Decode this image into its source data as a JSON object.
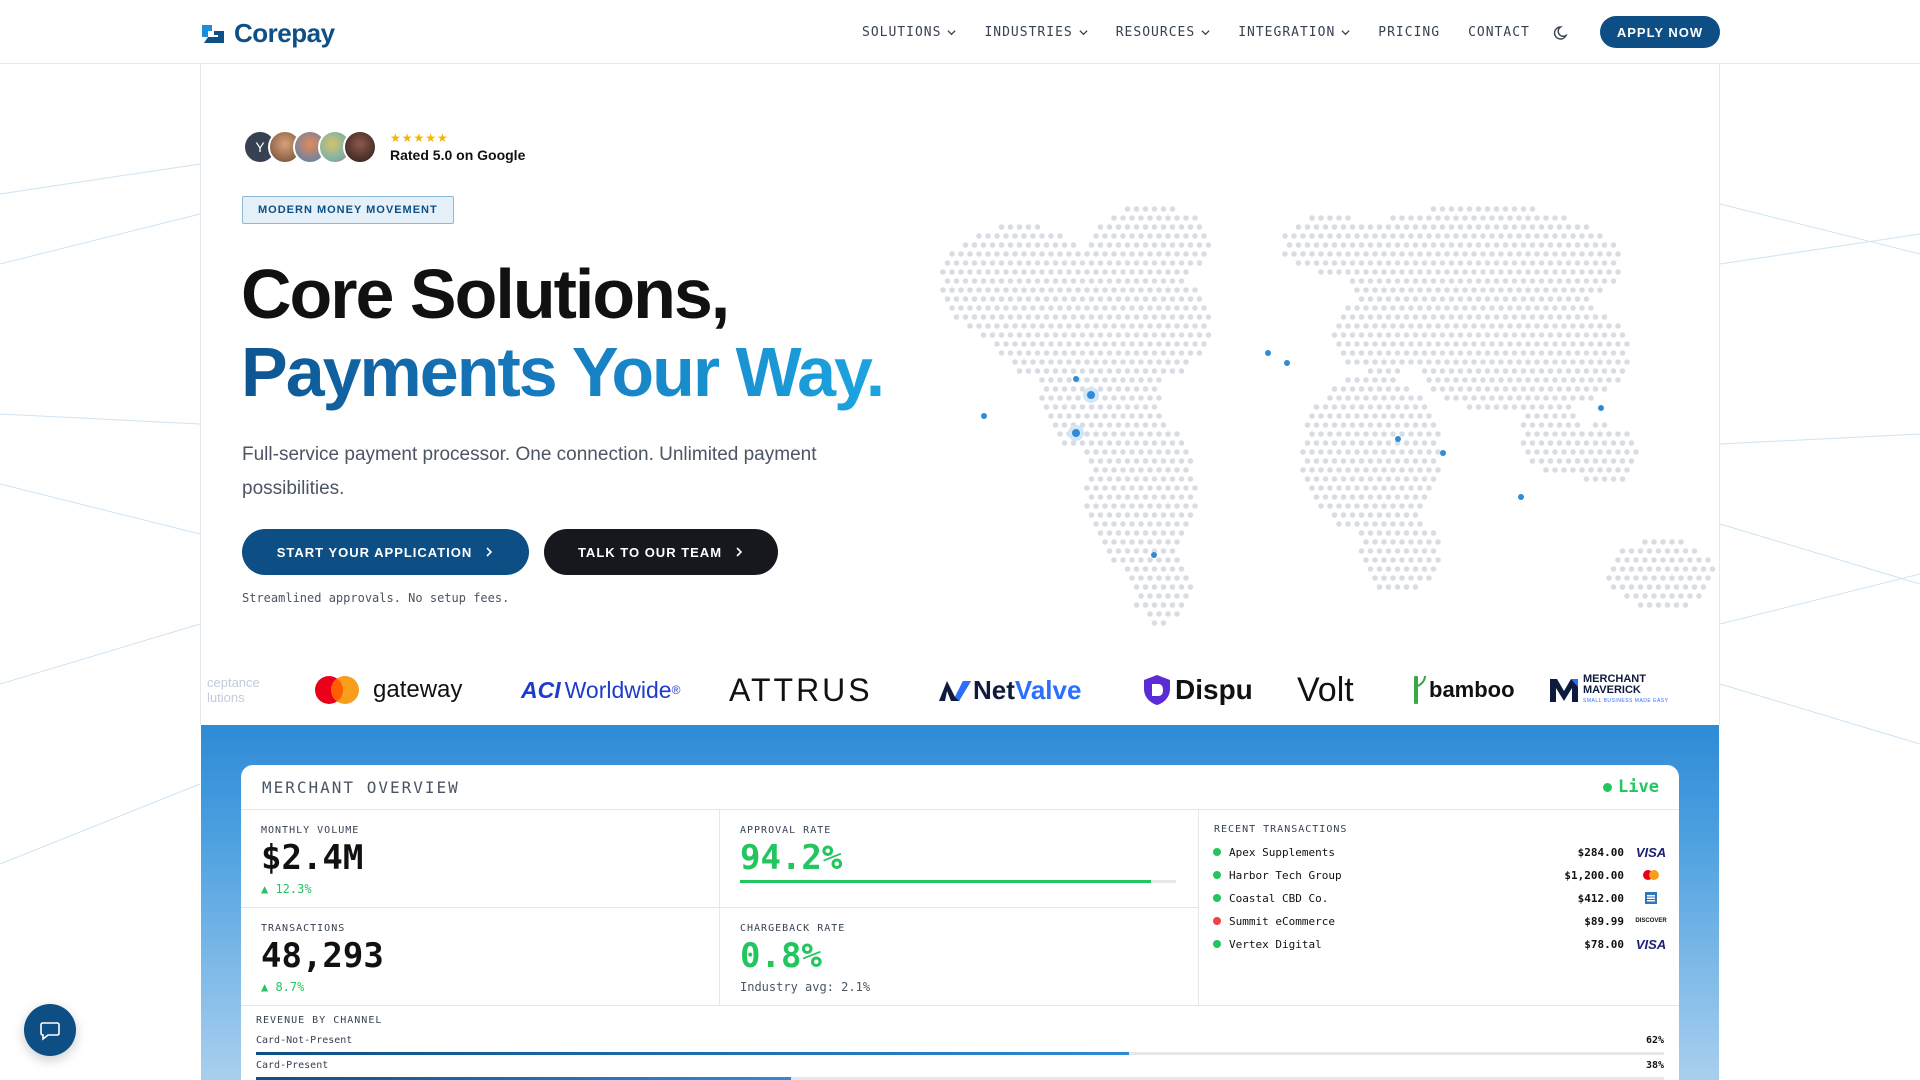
{
  "brand": {
    "name_part1": "Core",
    "name_part2": "pay"
  },
  "nav": {
    "items": [
      {
        "label": "SOLUTIONS",
        "dropdown": true
      },
      {
        "label": "INDUSTRIES",
        "dropdown": true
      },
      {
        "label": "RESOURCES",
        "dropdown": true
      },
      {
        "label": "INTEGRATION",
        "dropdown": true
      },
      {
        "label": "PRICING",
        "dropdown": false
      },
      {
        "label": "CONTACT",
        "dropdown": false
      }
    ],
    "theme_icon": "moon-icon",
    "apply_label": "APPLY NOW"
  },
  "hero": {
    "avatar_initial": "Y",
    "stars": "★★★★★",
    "rating_text": "Rated 5.0 on Google",
    "badge": "MODERN MONEY MOVEMENT",
    "headline_line1": "Core Solutions,",
    "headline_line2": "Payments Your Way.",
    "subtitle": "Full-service payment processor. One connection. Unlimited payment possibilities.",
    "cta_primary": "START YOUR APPLICATION",
    "cta_secondary": "TALK TO OUR TEAM",
    "note": "Streamlined approvals. No setup fees."
  },
  "partners": {
    "p0_line1": "ceptance",
    "p0_line2": "lutions",
    "p1": "gateway",
    "p2_a": "ACI",
    "p2_b": "Worldwide",
    "p2_mark": "®",
    "p3": "ATTRUS",
    "p4_a": "Net",
    "p4_b": "Valve",
    "p5": "Dispu",
    "p6": "Volt",
    "p7": "bamboo",
    "p8_line1": "MERCHANT",
    "p8_line2": "MAVERICK",
    "p8_line3": "SMALL BUSINESS MADE EASY"
  },
  "dashboard": {
    "title": "MERCHANT OVERVIEW",
    "live": "Live",
    "monthly_volume": {
      "label": "MONTHLY VOLUME",
      "value": "$2.4M",
      "delta": "▲ 12.3%"
    },
    "approval_rate": {
      "label": "APPROVAL RATE",
      "value": "94.2%",
      "progress": 0.942
    },
    "transactions": {
      "label": "TRANSACTIONS",
      "value": "48,293",
      "delta": "▲ 8.7%"
    },
    "chargeback_rate": {
      "label": "CHARGEBACK RATE",
      "value": "0.8%",
      "sub": "Industry avg: 2.1%"
    },
    "recent_title": "RECENT TRANSACTIONS",
    "recent": [
      {
        "name": "Apex Supplements",
        "amount": "$284.00",
        "status_color": "#22c55e",
        "card": "visa"
      },
      {
        "name": "Harbor Tech Group",
        "amount": "$1,200.00",
        "status_color": "#22c55e",
        "card": "mastercard"
      },
      {
        "name": "Coastal CBD Co.",
        "amount": "$412.00",
        "status_color": "#22c55e",
        "card": "amex"
      },
      {
        "name": "Summit eCommerce",
        "amount": "$89.99",
        "status_color": "#ef4444",
        "card": "discover"
      },
      {
        "name": "Vertex Digital",
        "amount": "$78.00",
        "status_color": "#22c55e",
        "card": "visa"
      }
    ],
    "card_labels": {
      "visa": "VISA",
      "discover": "DISCOVER"
    },
    "revenue_title": "REVENUE BY CHANNEL",
    "revenue": [
      {
        "label": "Card-Not-Present",
        "pct": "62%",
        "fraction": 0.62
      },
      {
        "label": "Card-Present",
        "pct": "38%",
        "fraction": 0.38
      }
    ]
  },
  "colors": {
    "brand_dark": "#0d4f85",
    "brand_light": "#1ca5e0",
    "positive": "#22c55e",
    "negative": "#ef4444"
  },
  "chat_icon": "chat-bubble-icon"
}
